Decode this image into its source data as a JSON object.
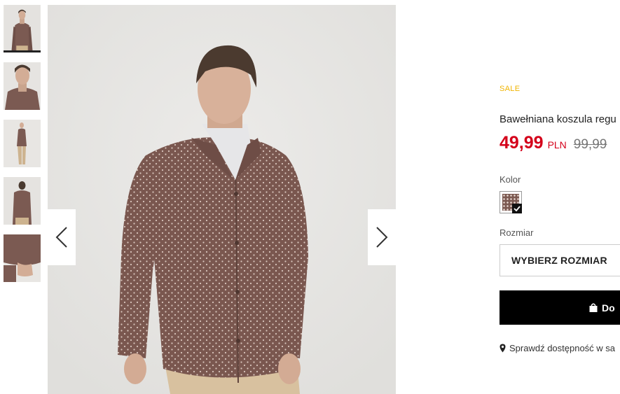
{
  "thumbnails": [
    {
      "view": "front-full",
      "active": true
    },
    {
      "view": "side-closeup",
      "active": false
    },
    {
      "view": "full-body",
      "active": false
    },
    {
      "view": "back",
      "active": false
    },
    {
      "view": "cuff-detail",
      "active": false
    }
  ],
  "gallery": {
    "prev_icon": "chevron-left-icon",
    "next_icon": "chevron-right-icon"
  },
  "product": {
    "badge": "SALE",
    "title": "Bawełniana koszula regu",
    "price": "49,99",
    "currency": "PLN",
    "old_price": "99,99"
  },
  "options": {
    "color_label": "Kolor",
    "size_label": "Rozmiar",
    "size_placeholder": "WYBIERZ ROZMIAR"
  },
  "actions": {
    "add_to_cart": "Do",
    "store_availability": "Sprawdź dostępność w sa"
  },
  "colors": {
    "sale": "#f0b400",
    "price": "#d4001a",
    "button": "#000000"
  }
}
